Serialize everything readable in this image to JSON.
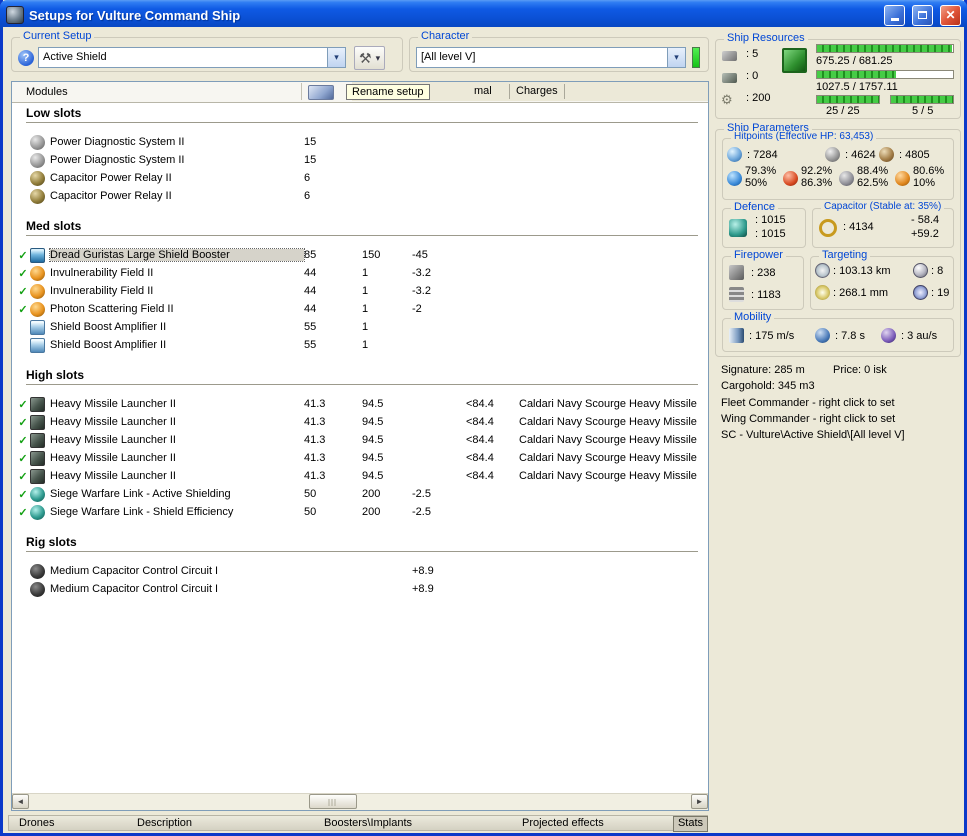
{
  "window": {
    "title": "Setups for Vulture Command Ship"
  },
  "icons": {
    "check": "✓",
    "dropdown_arrow": "▾",
    "scroll_left": "◄",
    "scroll_right": "►",
    "tool": "⚒",
    "help": "?",
    "gear": "⚙",
    "close": "✕"
  },
  "topbar": {
    "current_setup": {
      "label": "Current Setup",
      "value": "Active Shield"
    },
    "character": {
      "label": "Character",
      "value": "[All level V]"
    }
  },
  "modules_panel": {
    "header_label": "Modules",
    "tooltip": "Rename setup",
    "tab_partial": "mal",
    "tab_charges": "Charges",
    "sections": [
      {
        "title": "Low slots",
        "items": [
          {
            "icon": "power-diagnostic",
            "name": "Power Diagnostic System II",
            "c1": "15"
          },
          {
            "icon": "power-diagnostic",
            "name": "Power Diagnostic System II",
            "c1": "15"
          },
          {
            "icon": "cap-relay",
            "name": "Capacitor Power Relay II",
            "c1": "6"
          },
          {
            "icon": "cap-relay",
            "name": "Capacitor Power Relay II",
            "c1": "6"
          }
        ]
      },
      {
        "title": "Med slots",
        "items": [
          {
            "checked": true,
            "selected": true,
            "icon": "shield-booster",
            "name": "Dread Guristas Large Shield Booster",
            "c1": "85",
            "c2": "150",
            "c3": "-45"
          },
          {
            "checked": true,
            "icon": "hardener",
            "name": "Invulnerability Field II",
            "c1": "44",
            "c2": "1",
            "c3": "-3.2"
          },
          {
            "checked": true,
            "icon": "hardener",
            "name": "Invulnerability Field II",
            "c1": "44",
            "c2": "1",
            "c3": "-3.2"
          },
          {
            "checked": true,
            "icon": "hardener",
            "name": "Photon Scattering Field II",
            "c1": "44",
            "c2": "1",
            "c3": "-2"
          },
          {
            "icon": "shield-amp",
            "name": "Shield Boost Amplifier II",
            "c1": "55",
            "c2": "1"
          },
          {
            "icon": "shield-amp",
            "name": "Shield Boost Amplifier II",
            "c1": "55",
            "c2": "1"
          }
        ]
      },
      {
        "title": "High slots",
        "items": [
          {
            "checked": true,
            "icon": "launcher",
            "name": "Heavy Missile Launcher II",
            "c1": "41.3",
            "c2": "94.5",
            "c4": "<84.4",
            "charge": "Caldari Navy Scourge Heavy Missile"
          },
          {
            "checked": true,
            "icon": "launcher",
            "name": "Heavy Missile Launcher II",
            "c1": "41.3",
            "c2": "94.5",
            "c4": "<84.4",
            "charge": "Caldari Navy Scourge Heavy Missile"
          },
          {
            "checked": true,
            "icon": "launcher",
            "name": "Heavy Missile Launcher II",
            "c1": "41.3",
            "c2": "94.5",
            "c4": "<84.4",
            "charge": "Caldari Navy Scourge Heavy Missile"
          },
          {
            "checked": true,
            "icon": "launcher",
            "name": "Heavy Missile Launcher II",
            "c1": "41.3",
            "c2": "94.5",
            "c4": "<84.4",
            "charge": "Caldari Navy Scourge Heavy Missile"
          },
          {
            "checked": true,
            "icon": "launcher",
            "name": "Heavy Missile Launcher II",
            "c1": "41.3",
            "c2": "94.5",
            "c4": "<84.4",
            "charge": "Caldari Navy Scourge Heavy Missile"
          },
          {
            "checked": true,
            "icon": "siege-link",
            "name": "Siege Warfare Link - Active Shielding",
            "c1": "50",
            "c2": "200",
            "c3": "-2.5"
          },
          {
            "checked": true,
            "icon": "siege-link",
            "name": "Siege Warfare Link - Shield Efficiency",
            "c1": "50",
            "c2": "200",
            "c3": "-2.5"
          }
        ]
      },
      {
        "title": "Rig slots",
        "items": [
          {
            "icon": "rig",
            "name": "Medium Capacitor Control Circuit I",
            "c3": "+8.9"
          },
          {
            "icon": "rig",
            "name": "Medium Capacitor Control Circuit I",
            "c3": "+8.9"
          }
        ]
      }
    ]
  },
  "ship_resources": {
    "label": "Ship Resources",
    "turrets": ": 5",
    "launchers": ": 0",
    "calibration": ": 200",
    "cpu_text": "675.25 / 681.25",
    "cpu_pct": 99,
    "pg_text": "1027.5 / 1757.11",
    "pg_pct": 58,
    "cal_text": "25 / 25",
    "cal_pct": 100,
    "slots_text": "5 / 5",
    "slots_pct": 100
  },
  "ship_parameters": {
    "label": "Ship Parameters",
    "hitpoints": {
      "label": "Hitpoints (Effective HP: 63,453)",
      "shield": ": 7284",
      "armor": ": 4624",
      "hull": ": 4805",
      "resists": [
        {
          "top": "79.3%",
          "bottom": "50%"
        },
        {
          "top": "92.2%",
          "bottom": "86.3%"
        },
        {
          "top": "88.4%",
          "bottom": "62.5%"
        },
        {
          "top": "80.6%",
          "bottom": "10%"
        }
      ]
    },
    "defence": {
      "label": "Defence",
      "v1": ": 1015",
      "v2": ": 1015"
    },
    "capacitor": {
      "label": "Capacitor (Stable at: 35%)",
      "amount": ": 4134",
      "out": "- 58.4",
      "in": "+59.2"
    },
    "firepower": {
      "label": "Firepower",
      "volley": ": 238",
      "dps": ": 1183"
    },
    "targeting": {
      "label": "Targeting",
      "range": ": 103.13 km",
      "max_targets": ": 8",
      "scan_res": ": 268.1 mm",
      "sensor": ": 19"
    },
    "mobility": {
      "label": "Mobility",
      "speed": ": 175 m/s",
      "agility": ": 7.8 s",
      "warp": ": 3 au/s"
    }
  },
  "info": {
    "signature": "Signature: 285 m",
    "price": "Price: 0 isk",
    "cargohold": "Cargohold: 345 m3",
    "fleet": "Fleet Commander - right click to set",
    "wing": "Wing Commander - right click to set",
    "sc": "SC - Vulture\\Active Shield\\[All level V]"
  },
  "bottom_tabs": [
    {
      "label": "Drones"
    },
    {
      "label": "Description"
    },
    {
      "label": "Boosters\\Implants"
    },
    {
      "label": "Projected effects"
    },
    {
      "label": "Stats",
      "active": true
    }
  ]
}
